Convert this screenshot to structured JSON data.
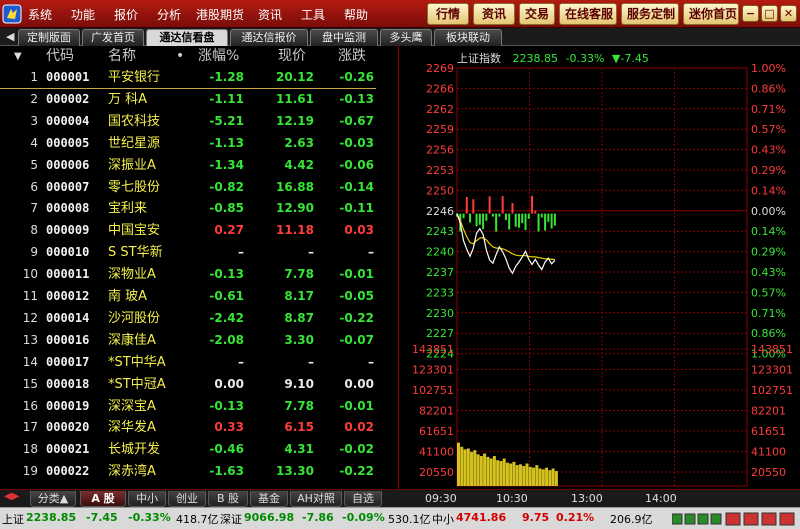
{
  "menubar": {
    "items": [
      "系统",
      "功能",
      "报价",
      "分析",
      "港股期货",
      "资讯",
      "工具",
      "帮助"
    ],
    "pills": [
      "行情",
      "资讯",
      "交易",
      "在线客服",
      "服务定制",
      "迷你首页"
    ],
    "window_buttons": [
      "−",
      "□",
      "✕"
    ]
  },
  "tabs": {
    "items": [
      "定制版面",
      "广发首页",
      "通达信看盘",
      "通达信报价",
      "盘中监测",
      "多头鹰",
      "板块联动"
    ],
    "active_index": 2
  },
  "table": {
    "headers": {
      "code": "代码",
      "name": "名称",
      "dot": "•",
      "pct": "涨幅%",
      "price": "现价",
      "chg": "涨跌"
    },
    "sort_glyph": "▼",
    "rows": [
      {
        "idx": "1",
        "code": "000001",
        "name": "平安银行",
        "pct": "-1.28",
        "price": "20.12",
        "chg": "-0.26",
        "dir": "down"
      },
      {
        "idx": "2",
        "code": "000002",
        "name": "万  科A",
        "pct": "-1.11",
        "price": "11.61",
        "chg": "-0.13",
        "dir": "down"
      },
      {
        "idx": "3",
        "code": "000004",
        "name": "国农科技",
        "pct": "-5.21",
        "price": "12.19",
        "chg": "-0.67",
        "dir": "down"
      },
      {
        "idx": "4",
        "code": "000005",
        "name": "世纪星源",
        "pct": "-1.13",
        "price": "2.63",
        "chg": "-0.03",
        "dir": "down"
      },
      {
        "idx": "5",
        "code": "000006",
        "name": "深振业A",
        "pct": "-1.34",
        "price": "4.42",
        "chg": "-0.06",
        "dir": "down"
      },
      {
        "idx": "6",
        "code": "000007",
        "name": "零七股份",
        "pct": "-0.82",
        "price": "16.88",
        "chg": "-0.14",
        "dir": "down"
      },
      {
        "idx": "7",
        "code": "000008",
        "name": "宝利来",
        "pct": "-0.85",
        "price": "12.90",
        "chg": "-0.11",
        "dir": "down"
      },
      {
        "idx": "8",
        "code": "000009",
        "name": "中国宝安",
        "pct": "0.27",
        "price": "11.18",
        "chg": "0.03",
        "dir": "up"
      },
      {
        "idx": "9",
        "code": "000010",
        "name": "S ST华新",
        "pct": "–",
        "price": "–",
        "chg": "–",
        "dir": "flat"
      },
      {
        "idx": "10",
        "code": "000011",
        "name": "深物业A",
        "pct": "-0.13",
        "price": "7.78",
        "chg": "-0.01",
        "dir": "down"
      },
      {
        "idx": "11",
        "code": "000012",
        "name": "南  玻A",
        "pct": "-0.61",
        "price": "8.17",
        "chg": "-0.05",
        "dir": "down"
      },
      {
        "idx": "12",
        "code": "000014",
        "name": "沙河股份",
        "pct": "-2.42",
        "price": "8.87",
        "chg": "-0.22",
        "dir": "down"
      },
      {
        "idx": "13",
        "code": "000016",
        "name": "深康佳A",
        "pct": "-2.08",
        "price": "3.30",
        "chg": "-0.07",
        "dir": "down"
      },
      {
        "idx": "14",
        "code": "000017",
        "name": "*ST中华A",
        "pct": "–",
        "price": "–",
        "chg": "–",
        "dir": "flat"
      },
      {
        "idx": "15",
        "code": "000018",
        "name": "*ST中冠A",
        "pct": "0.00",
        "price": "9.10",
        "chg": "0.00",
        "dir": "flat"
      },
      {
        "idx": "16",
        "code": "000019",
        "name": "深深宝A",
        "pct": "-0.13",
        "price": "7.78",
        "chg": "-0.01",
        "dir": "down"
      },
      {
        "idx": "17",
        "code": "000020",
        "name": "深华发A",
        "pct": "0.33",
        "price": "6.15",
        "chg": "0.02",
        "dir": "up"
      },
      {
        "idx": "18",
        "code": "000021",
        "name": "长城开发",
        "pct": "-0.46",
        "price": "4.31",
        "chg": "-0.02",
        "dir": "down"
      },
      {
        "idx": "19",
        "code": "000022",
        "name": "深赤湾A",
        "pct": "-1.63",
        "price": "13.30",
        "chg": "-0.22",
        "dir": "down"
      }
    ]
  },
  "chart": {
    "title": "上证指数",
    "last": "2238.85",
    "pct": "-0.33%",
    "chg": "▼-7.45",
    "price_ticks": [
      "2269",
      "2266",
      "2262",
      "2259",
      "2256",
      "2253",
      "2250",
      "2246",
      "2243",
      "2240",
      "2237",
      "2233",
      "2230",
      "2227",
      "2224"
    ],
    "pct_ticks": [
      "1.00%",
      "0.86%",
      "0.71%",
      "0.57%",
      "0.43%",
      "0.29%",
      "0.14%",
      "0.00%",
      "0.14%",
      "0.29%",
      "0.43%",
      "0.57%",
      "0.71%",
      "0.86%",
      "1.00%"
    ],
    "volume_ticks": [
      "143851",
      "123301",
      "102751",
      "82201",
      "61651",
      "41100",
      "20550"
    ],
    "time_ticks": [
      "09:30",
      "10:30",
      "13:00",
      "14:00"
    ],
    "base_price": 2246.3,
    "price_series": [
      2246.3,
      2244.8,
      2242.0,
      2240.6,
      2239.5,
      2240.8,
      2243.2,
      2243.9,
      2243.0,
      2240.5,
      2238.9,
      2238.4,
      2239.8,
      2241.0,
      2240.2,
      2239.1,
      2237.6,
      2236.8,
      2237.9,
      2238.6,
      2239.4,
      2240.3,
      2239.0,
      2238.2,
      2239.0,
      2238.1,
      2237.4,
      2238.6,
      2239.2,
      2238.3,
      2238.85
    ],
    "avg_series": [
      2246.3,
      2245.2,
      2243.8,
      2242.6,
      2241.7,
      2241.5,
      2242.0,
      2242.4,
      2242.5,
      2242.1,
      2241.5,
      2241.0,
      2240.8,
      2240.8,
      2240.7,
      2240.5,
      2240.2,
      2239.9,
      2239.7,
      2239.6,
      2239.6,
      2239.6,
      2239.5,
      2239.4,
      2239.4,
      2239.3,
      2239.2,
      2239.1,
      2239.1,
      2239.0,
      2239.0
    ],
    "volume_series": [
      52000,
      47000,
      44000,
      45000,
      41000,
      43000,
      38000,
      36000,
      39000,
      35000,
      33000,
      36000,
      31000,
      30000,
      33000,
      28000,
      27000,
      29000,
      25000,
      26000,
      24000,
      27000,
      23000,
      22000,
      25000,
      21000,
      20000,
      22000,
      19000,
      21000,
      18000
    ],
    "volume_max": 164401
  },
  "bottom": {
    "tabs": [
      "分类▲",
      "A 股",
      "中小",
      "创业",
      "B 股",
      "基金",
      "AH对照",
      "自选"
    ],
    "active_index": 1
  },
  "status": {
    "sh_label": "上证",
    "sh_last": "2238.85",
    "sh_chg": "-7.45",
    "sh_pct": "-0.33%",
    "sh_amt": "418.7亿",
    "sz_label": "深证",
    "sz_last": "9066.98",
    "sz_chg": "-7.86",
    "sz_pct": "-0.09%",
    "sz_amt": "530.1亿",
    "zx_label": "中小",
    "zx_last": "4741.86",
    "zx_chg": "9.75",
    "zx_pct": "0.21%",
    "zx_amt": "206.9亿"
  },
  "colors": {
    "up": "#ff3b3b",
    "down": "#36e536",
    "grid": "#8a0000",
    "volume": "#d6c21f",
    "price_line": "#ffffff",
    "avg_line": "#e8d000"
  }
}
